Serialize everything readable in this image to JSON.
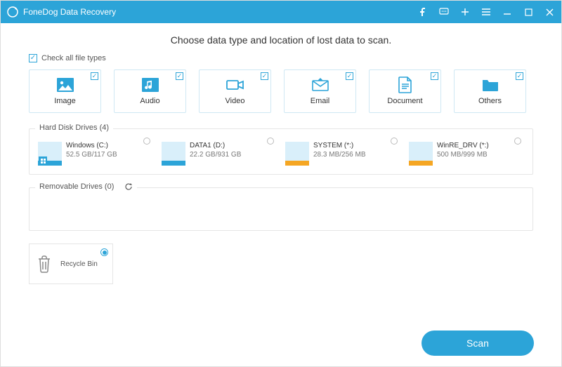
{
  "titlebar": {
    "title": "FoneDog Data Recovery"
  },
  "prompt": "Choose data type and location of lost data to scan.",
  "check_all_label": "Check all file types",
  "types": [
    {
      "label": "Image",
      "icon": "image"
    },
    {
      "label": "Audio",
      "icon": "audio"
    },
    {
      "label": "Video",
      "icon": "video"
    },
    {
      "label": "Email",
      "icon": "email"
    },
    {
      "label": "Document",
      "icon": "document"
    },
    {
      "label": "Others",
      "icon": "folder"
    }
  ],
  "hdd": {
    "legend": "Hard Disk Drives (4)",
    "drives": [
      {
        "name": "Windows (C:)",
        "size": "52.5 GB/117 GB",
        "style": "blue",
        "badge": true
      },
      {
        "name": "DATA1 (D:)",
        "size": "22.2 GB/931 GB",
        "style": "blue",
        "badge": false
      },
      {
        "name": "SYSTEM (*:)",
        "size": "28.3 MB/256 MB",
        "style": "orange",
        "badge": false
      },
      {
        "name": "WinRE_DRV (*:)",
        "size": "500 MB/999 MB",
        "style": "orange",
        "badge": false
      }
    ]
  },
  "removable": {
    "legend": "Removable Drives (0)"
  },
  "recycle": {
    "label": "Recycle Bin"
  },
  "scan_label": "Scan"
}
